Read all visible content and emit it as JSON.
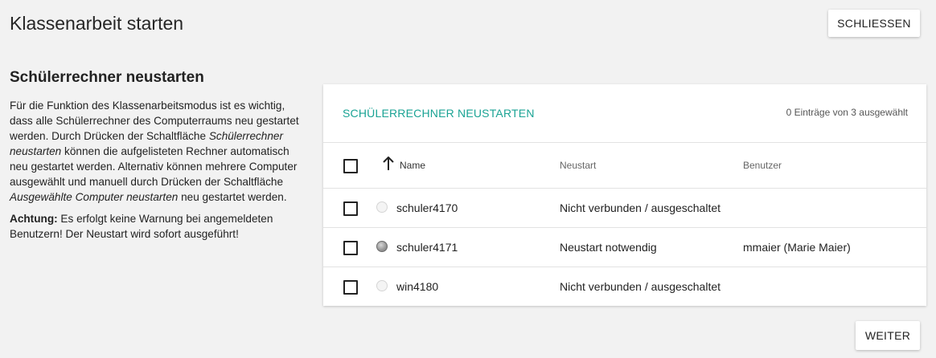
{
  "header": {
    "title": "Klassenarbeit starten",
    "close_label": "SCHLIESSEN"
  },
  "section": {
    "title": "Schülerrechner neustarten",
    "p1_a": "Für die Funktion des Klassenarbeitsmodus ist es wichtig, dass alle Schülerrechner des Computerraums neu gestartet werden. Durch Drücken der Schaltfläche ",
    "p1_em1": "Schülerrechner neustarten",
    "p1_b": " können die aufgelisteten Rechner automatisch neu gestartet werden. Alternativ können mehrere Computer ausgewählt und manuell durch Drücken der Schaltfläche ",
    "p1_em2": "Ausgewählte Computer neustarten",
    "p1_c": " neu gestartet werden.",
    "p2_strong": "Achtung:",
    "p2_rest": " Es erfolgt keine Warnung bei angemeldeten Benutzern! Der Neustart wird sofort ausgeführt!"
  },
  "table": {
    "title": "SCHÜLERRECHNER NEUSTARTEN",
    "selection_count": "0 Einträge von 3 ausgewählt",
    "columns": {
      "name": "Name",
      "restart": "Neustart",
      "user": "Benutzer"
    },
    "rows": [
      {
        "name": "schuler4170",
        "status": "Nicht verbunden / ausgeschaltet",
        "user": "",
        "online": false
      },
      {
        "name": "schuler4171",
        "status": "Neustart notwendig",
        "user": "mmaier (Marie Maier)",
        "online": true
      },
      {
        "name": "win4180",
        "status": "Nicht verbunden / ausgeschaltet",
        "user": "",
        "online": false
      }
    ]
  },
  "footer": {
    "next_label": "WEITER"
  },
  "colors": {
    "accent": "#1aa394",
    "background": "#f2f2f2"
  }
}
